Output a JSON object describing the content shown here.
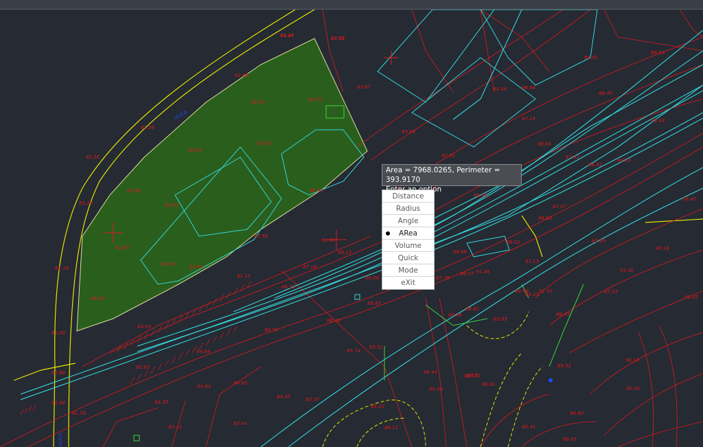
{
  "colors": {
    "background": "#252a33",
    "contour_red": "#e0191c",
    "rail_cyan": "#33d6d9",
    "boundary_yellow": "#e6e600",
    "area_fill_green": "#2a5e1c",
    "tooltip_bg": "#4a4d52"
  },
  "measure": {
    "line1": "Area = 7968.0265, Perimeter = 393.9170",
    "line2": "Enter an option"
  },
  "menu": {
    "selected": "ARea",
    "options": [
      {
        "label": "Distance",
        "selected": false
      },
      {
        "label": "Radius",
        "selected": false
      },
      {
        "label": "Angle",
        "selected": false
      },
      {
        "label": "ARea",
        "selected": true
      },
      {
        "label": "Volume",
        "selected": false
      },
      {
        "label": "Quick",
        "selected": false
      },
      {
        "label": "Mode",
        "selected": false
      },
      {
        "label": "eXit",
        "selected": false
      }
    ]
  },
  "elevations": [
    "82.16",
    "83.51",
    "81.66",
    "81.36",
    "81.56",
    "81.20",
    "81.18",
    "81.00",
    "80.68",
    "81.06",
    "81.78",
    "80.50",
    "82.40",
    "82.51",
    "82.44",
    "82.60",
    "81.90",
    "82.67",
    "82.63",
    "82.58",
    "82.62",
    "81.15",
    "80.95",
    "83.67",
    "83.69",
    "83.46",
    "87.02",
    "85.95",
    "87.07",
    "87.23",
    "86.85",
    "86.40",
    "86.56",
    "86.51",
    "85.43",
    "87.33",
    "86.92",
    "86.33",
    "86.85",
    "86.86",
    "88.03",
    "86.40",
    "86.15",
    "87.18",
    "86.31",
    "86.87",
    "86.56",
    "87.13",
    "86.07",
    "86.25",
    "86.36",
    "85.74",
    "85.91",
    "84.39",
    "85.37",
    "88.49",
    "86.70",
    "86.71",
    "86.61",
    "85.65",
    "86.66",
    "87.15",
    "88.43",
    "85.95",
    "84.93",
    "84.84",
    "85.65",
    "84.94",
    "83.35",
    "83.41",
    "83.53",
    "84.90",
    "85.44",
    "85.22",
    "86.12",
    "86.44",
    "86.73",
    "85.45",
    "89.46",
    "89.41",
    "89.45",
    "89.52",
    "90.16",
    "91.40",
    "91.42",
    "90.60",
    "90.40",
    "90.16",
    "91.42",
    "91.48",
    "88.81",
    "87.76",
    "86.66",
    "85.40",
    "87.40"
  ]
}
